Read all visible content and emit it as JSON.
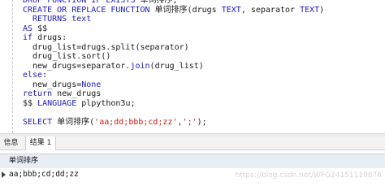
{
  "editor": {
    "lines": [
      [
        {
          "t": "DROP FUNCTION IF EXISTS ",
          "k": "kw"
        },
        {
          "t": "单词排序;",
          "k": ""
        }
      ],
      [
        {
          "t": "CREATE OR REPLACE FUNCTION ",
          "k": "kw"
        },
        {
          "t": "单词排序(drugs ",
          "k": ""
        },
        {
          "t": "TEXT",
          "k": "kw"
        },
        {
          "t": ", separator ",
          "k": ""
        },
        {
          "t": "TEXT",
          "k": "kw"
        },
        {
          "t": ")",
          "k": ""
        }
      ],
      [
        {
          "t": "  RETURNS text",
          "k": "kw"
        }
      ],
      [
        {
          "t": "AS",
          "k": "kw"
        },
        {
          "t": " $$",
          "k": ""
        }
      ],
      [
        {
          "t": "if",
          "k": "kw"
        },
        {
          "t": " drugs:",
          "k": ""
        }
      ],
      [
        {
          "t": "  drug_list=drugs.split(separator)",
          "k": ""
        }
      ],
      [
        {
          "t": "  drug_list.sort()",
          "k": ""
        }
      ],
      [
        {
          "t": "  new_drugs=separator.",
          "k": ""
        },
        {
          "t": "join",
          "k": "kw"
        },
        {
          "t": "(drug_list)",
          "k": ""
        }
      ],
      [
        {
          "t": "else",
          "k": "kw"
        },
        {
          "t": ":",
          "k": ""
        }
      ],
      [
        {
          "t": "  new_drugs=",
          "k": ""
        },
        {
          "t": "None",
          "k": "kw"
        }
      ],
      [
        {
          "t": "return",
          "k": "kw"
        },
        {
          "t": " new_drugs",
          "k": ""
        }
      ],
      [
        {
          "t": "$$ ",
          "k": ""
        },
        {
          "t": "LANGUAGE",
          "k": "kw"
        },
        {
          "t": " plpython3u;",
          "k": ""
        }
      ],
      [
        {
          "t": "",
          "k": ""
        }
      ],
      [
        {
          "t": "SELECT",
          "k": "kw"
        },
        {
          "t": " 单词排序(",
          "k": ""
        },
        {
          "t": "'aa;dd;bbb;cd;zz'",
          "k": "str"
        },
        {
          "t": ",",
          "k": ""
        },
        {
          "t": "';'",
          "k": "str"
        },
        {
          "t": ");",
          "k": ""
        }
      ]
    ]
  },
  "results": {
    "tabs": {
      "info": "信息",
      "result": "结果 1"
    },
    "column_header": "单词排序",
    "rows": [
      "aa;bbb;cd;dd;zz"
    ],
    "watermark": "https://blog.csdn.net/WFG24151110876"
  }
}
